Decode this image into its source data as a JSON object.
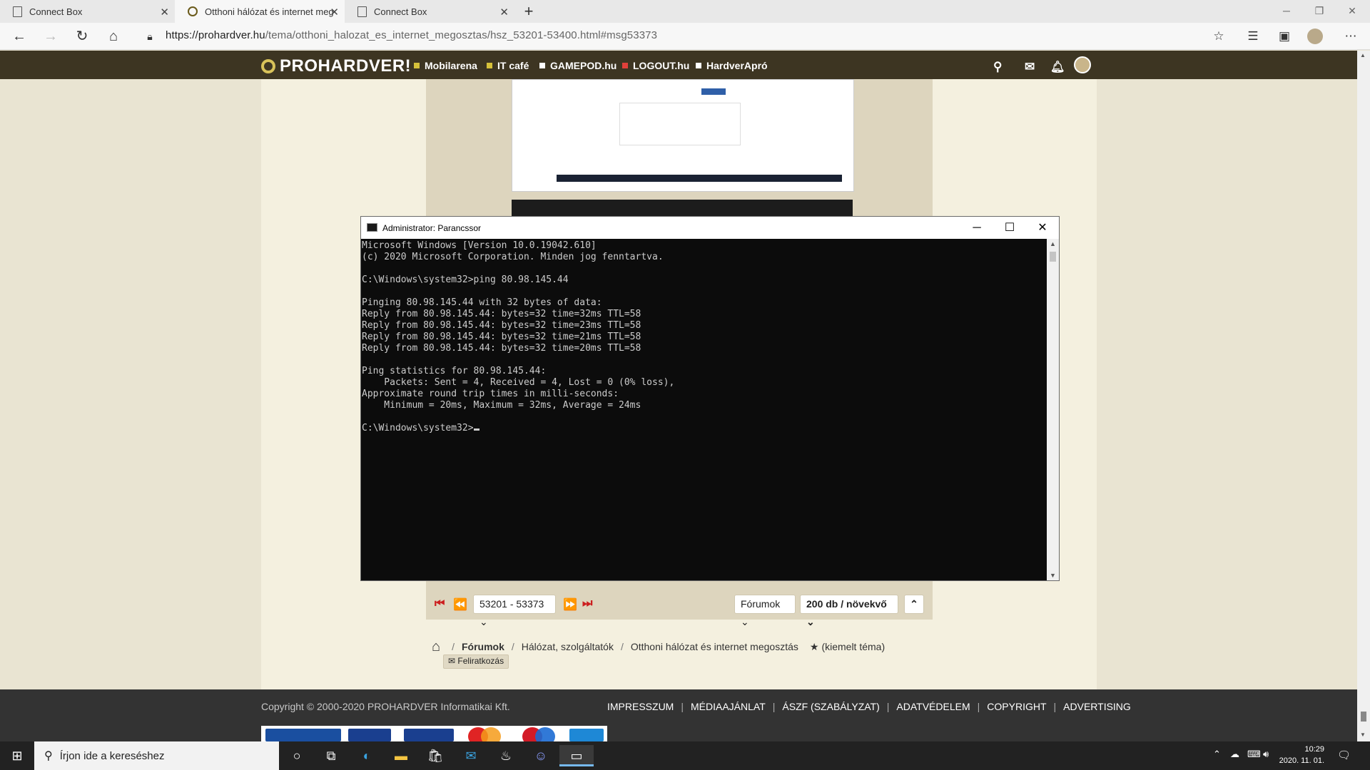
{
  "browser": {
    "tabs": [
      {
        "title": "Connect Box",
        "close": "✕"
      },
      {
        "title": "Otthoni hálózat és internet meg…",
        "close": "✕"
      },
      {
        "title": "Connect Box",
        "close": "✕"
      }
    ],
    "new_tab": "+",
    "url_host": "https://prohardver.hu",
    "url_path": "/tema/otthoni_halozat_es_internet_megosztas/hsz_53201-53400.html#msg53373"
  },
  "site_nav": {
    "logo": "PROHARDVER!",
    "links": [
      {
        "label": "Mobilarena",
        "color": "#d6c13a"
      },
      {
        "label": "IT café",
        "color": "#d6c13a"
      },
      {
        "label": "GAMEPOD.hu",
        "color": "#ffffff"
      },
      {
        "label": "LOGOUT.hu",
        "color": "#e0403a"
      },
      {
        "label": "HardverApró",
        "color": "#ffffff"
      }
    ]
  },
  "cmd": {
    "title": "Administrator: Parancssor",
    "lines": [
      "Microsoft Windows [Version 10.0.19042.610]",
      "(c) 2020 Microsoft Corporation. Minden jog fenntartva.",
      "",
      "C:\\Windows\\system32>ping 80.98.145.44",
      "",
      "Pinging 80.98.145.44 with 32 bytes of data:",
      "Reply from 80.98.145.44: bytes=32 time=32ms TTL=58",
      "Reply from 80.98.145.44: bytes=32 time=23ms TTL=58",
      "Reply from 80.98.145.44: bytes=32 time=21ms TTL=58",
      "Reply from 80.98.145.44: bytes=32 time=20ms TTL=58",
      "",
      "Ping statistics for 80.98.145.44:",
      "    Packets: Sent = 4, Received = 4, Lost = 0 (0% loss),",
      "Approximate round trip times in milli-seconds:",
      "    Minimum = 20ms, Maximum = 32ms, Average = 24ms",
      "",
      "C:\\Windows\\system32>"
    ]
  },
  "pager": {
    "range": "53201 - 53373",
    "forum_select": "Fórumok",
    "per_page": "200 db / ",
    "order": "növekvő"
  },
  "breadcrumb": {
    "items": [
      "Fórumok",
      "Hálózat, szolgáltatók",
      "Otthoni hálózat és internet megosztás"
    ],
    "separator": "/",
    "featured": "(kiemelt téma)",
    "subscribe": "Feliratkozás"
  },
  "footer": {
    "copyright": "Copyright © 2000-2020 PROHARDVER Informatikai Kft.",
    "links": [
      "IMPRESSZUM",
      "MÉDIAAJÁNLAT",
      "ÁSZF (SZABÁLYZAT)",
      "ADATVÉDELEM",
      "COPYRIGHT",
      "ADVERTISING"
    ],
    "separator": "|"
  },
  "taskbar": {
    "search_placeholder": "Írjon ide a kereséshez",
    "time": "10:29",
    "date": "2020. 11. 01."
  }
}
